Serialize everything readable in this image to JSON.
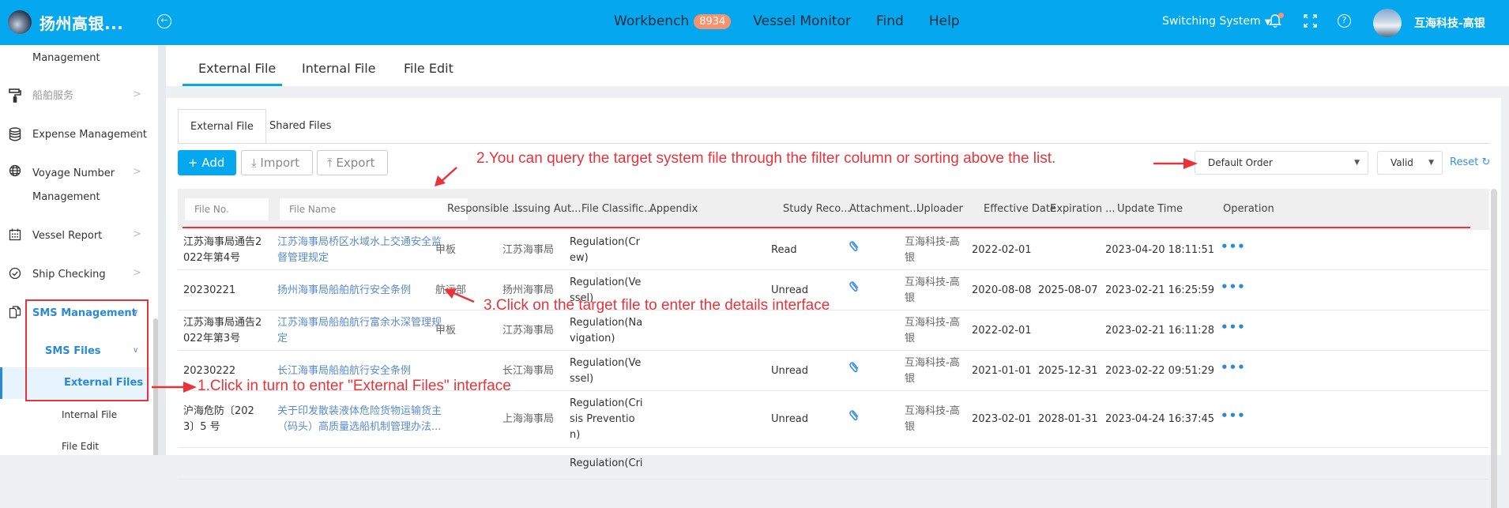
{
  "header": {
    "brand": "扬州高银...",
    "nav": [
      {
        "label": "Workbench",
        "badge": "8934"
      },
      {
        "label": "Vessel Monitor"
      },
      {
        "label": "Find"
      },
      {
        "label": "Help"
      }
    ],
    "switching_system": "Switching System",
    "user_name": "互海科技-高银"
  },
  "sidebar": {
    "items": [
      {
        "label": "Management",
        "icon": "none"
      },
      {
        "label": "船舶服务",
        "icon": "paint-roller-icon",
        "disabled": true
      },
      {
        "label": "Expense Management",
        "icon": "database-icon"
      },
      {
        "label": "Voyage Number",
        "label2": "Management",
        "icon": "globe-icon"
      },
      {
        "label": "Vessel Report",
        "icon": "calendar-icon"
      },
      {
        "label": "Ship Checking",
        "icon": "check-circle-icon"
      },
      {
        "label": "SMS Management",
        "icon": "documents-icon",
        "expanded": true
      },
      {
        "label": "SMS Files",
        "expanded": true
      },
      {
        "label": "External Files",
        "active": true
      },
      {
        "label": "Internal File"
      },
      {
        "label": "File Edit"
      }
    ]
  },
  "tabs": [
    {
      "label": "External File",
      "active": true
    },
    {
      "label": "Internal File"
    },
    {
      "label": "File Edit"
    }
  ],
  "subtabs": [
    {
      "label": "External File",
      "active": true
    },
    {
      "label": "Shared Files"
    }
  ],
  "toolbar": {
    "add": "Add",
    "import": "Import",
    "export": "Export",
    "sort_select": "Default Order",
    "status_select": "Valid",
    "reset": "Reset"
  },
  "table": {
    "filters": {
      "file_no_placeholder": "File No.",
      "file_name_placeholder": "File Name"
    },
    "columns": [
      "Responsible ...",
      "Issuing Aut...",
      "File Classific...",
      "Appendix",
      "Study Reco...",
      "Attachment...",
      "Uploader",
      "Effective Date",
      "Expiration ...",
      "Update Time",
      "Operation"
    ],
    "rows": [
      {
        "file_no": [
          "江苏海事局通告2",
          "022年第4号"
        ],
        "file_name": [
          "江苏海事局桥区水域水上交通安全监",
          "督管理规定"
        ],
        "responsible": "甲板",
        "issuing": "江苏海事局",
        "classification": [
          "Regulation(Cr",
          "ew)"
        ],
        "appendix": "",
        "study": "Read",
        "attachment": true,
        "uploader": [
          "互海科技-高",
          "银"
        ],
        "effective": "2022-02-01",
        "expiration": "",
        "update": "2023-04-20 18:11:51"
      },
      {
        "file_no": [
          "20230221"
        ],
        "file_name": [
          "扬州海事局船舶航行安全条例"
        ],
        "responsible": "航运部",
        "issuing": "扬州海事局",
        "classification": [
          "Regulation(Ve",
          "ssel)"
        ],
        "appendix": "",
        "study": "Unread",
        "attachment": true,
        "uploader": [
          "互海科技-高",
          "银"
        ],
        "effective": "2020-08-08",
        "expiration": "2025-08-07",
        "update": "2023-02-21 16:25:59"
      },
      {
        "file_no": [
          "江苏海事局通告2",
          "022年第3号"
        ],
        "file_name": [
          "江苏海事局船舶航行富余水深管理规",
          "定"
        ],
        "responsible": "甲板",
        "issuing": "江苏海事局",
        "classification": [
          "Regulation(Na",
          "vigation)"
        ],
        "appendix": "",
        "study": "",
        "attachment": false,
        "uploader": [
          "互海科技-高",
          "银"
        ],
        "effective": "2022-02-01",
        "expiration": "",
        "update": "2023-02-21 16:11:28"
      },
      {
        "file_no": [
          "20230222"
        ],
        "file_name": [
          "长江海事局船舶航行安全条例"
        ],
        "responsible": "",
        "issuing": "长江海事局",
        "classification": [
          "Regulation(Ve",
          "ssel)"
        ],
        "appendix": "",
        "study": "Unread",
        "attachment": true,
        "uploader": [
          "互海科技-高",
          "银"
        ],
        "effective": "2021-01-01",
        "expiration": "2025-12-31",
        "update": "2023-02-22 09:51:29"
      },
      {
        "file_no": [
          "沪海危防〔202",
          "3〕5 号"
        ],
        "file_name": [
          "关于印发散装液体危险货物运输货主",
          "（码头）高质量选船机制管理办法..."
        ],
        "responsible": "",
        "issuing": "上海海事局",
        "classification": [
          "Regulation(Cri",
          "sis Preventio",
          "n)"
        ],
        "appendix": "",
        "study": "Unread",
        "attachment": true,
        "uploader": [
          "互海科技-高",
          "银"
        ],
        "effective": "2023-02-01",
        "expiration": "2028-01-31",
        "update": "2023-04-24 16:37:45"
      },
      {
        "file_no": [
          ""
        ],
        "file_name": [
          ""
        ],
        "responsible": "",
        "issuing": "",
        "classification": [
          "Regulation(Cri"
        ],
        "appendix": "",
        "study": "",
        "attachment": false,
        "uploader": [
          ""
        ],
        "effective": "",
        "expiration": "",
        "update": ""
      }
    ],
    "ops_glyph": "•••"
  },
  "annotations": {
    "step1": "1.Click in turn to enter \"External Files\" interface",
    "step2": "2.You can query the target system file through the filter column or sorting above the list.",
    "step3": "3.Click on the target file to enter the details interface",
    "color": "#e8333a"
  },
  "colors": {
    "header_bg": "#05a8ee",
    "accent": "#2a8ad8",
    "badge": "#f7926e",
    "annotation": "#e8333a"
  }
}
